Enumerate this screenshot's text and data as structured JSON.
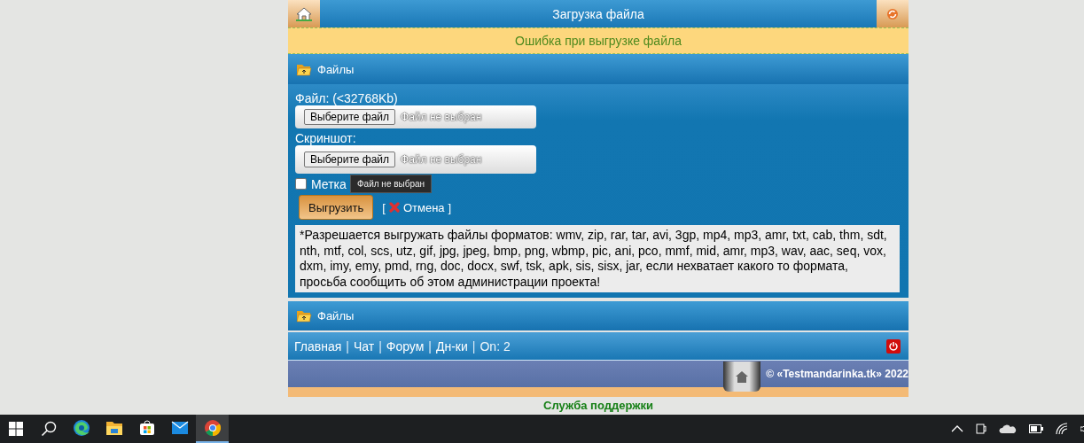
{
  "header": {
    "title": "Загрузка файла"
  },
  "error": "Ошибка при выгрузке файла",
  "section_title": "Файлы",
  "form": {
    "file_label": "Файл: (<32768Kb)",
    "file_button": "Выберите файл",
    "file_status": "Файл не выбран",
    "screenshot_label": "Скриншот:",
    "screenshot_button": "Выберите файл",
    "screenshot_status": "Файл не выбран",
    "tooltip": "Файл не выбран",
    "checkbox": {
      "label": "Метка",
      "checked": false
    },
    "submit": "Выгрузить",
    "cancel_open": "[",
    "cancel": "Отмена",
    "cancel_close": "]"
  },
  "notice": "*Разрешается выгружать файлы форматов: wmv, zip, rar, tar, avi, 3gp, mp4, mp3, amr, txt, cab, thm, sdt, nth, mtf, col, scs, utz, gif, jpg, jpeg, bmp, png, wbmp, pic, ani, pco, mmf, mid, amr, mp3, wav, aac, seq, vox, dxm, imy, emy, pmd, rng, doc, docx, swf, tsk, apk, sis, sisx, jar, если нехватает какого то формата, просьба сообщить об этом администрации проекта!",
  "section_title_2": "Файлы",
  "nav": [
    {
      "label": "Главная",
      "kind": "link"
    },
    {
      "label": "|",
      "kind": "separator"
    },
    {
      "label": "Чат",
      "kind": "link"
    },
    {
      "label": "|",
      "kind": "separator"
    },
    {
      "label": "Форум",
      "kind": "link"
    },
    {
      "label": "|",
      "kind": "separator"
    },
    {
      "label": "Дн-ки",
      "kind": "link"
    },
    {
      "label": "|",
      "kind": "separator"
    },
    {
      "label": "On: 2",
      "kind": "text"
    }
  ],
  "copyright": "© «Testmandarinka.tk» 2022",
  "support": "Служба поддержки",
  "taskbar": {
    "apps": [
      {
        "kind": "edge",
        "selected": false
      },
      {
        "kind": "explorer",
        "selected": false
      },
      {
        "kind": "store",
        "selected": false
      },
      {
        "kind": "mail",
        "selected": false
      },
      {
        "kind": "chrome",
        "selected": true
      }
    ]
  }
}
